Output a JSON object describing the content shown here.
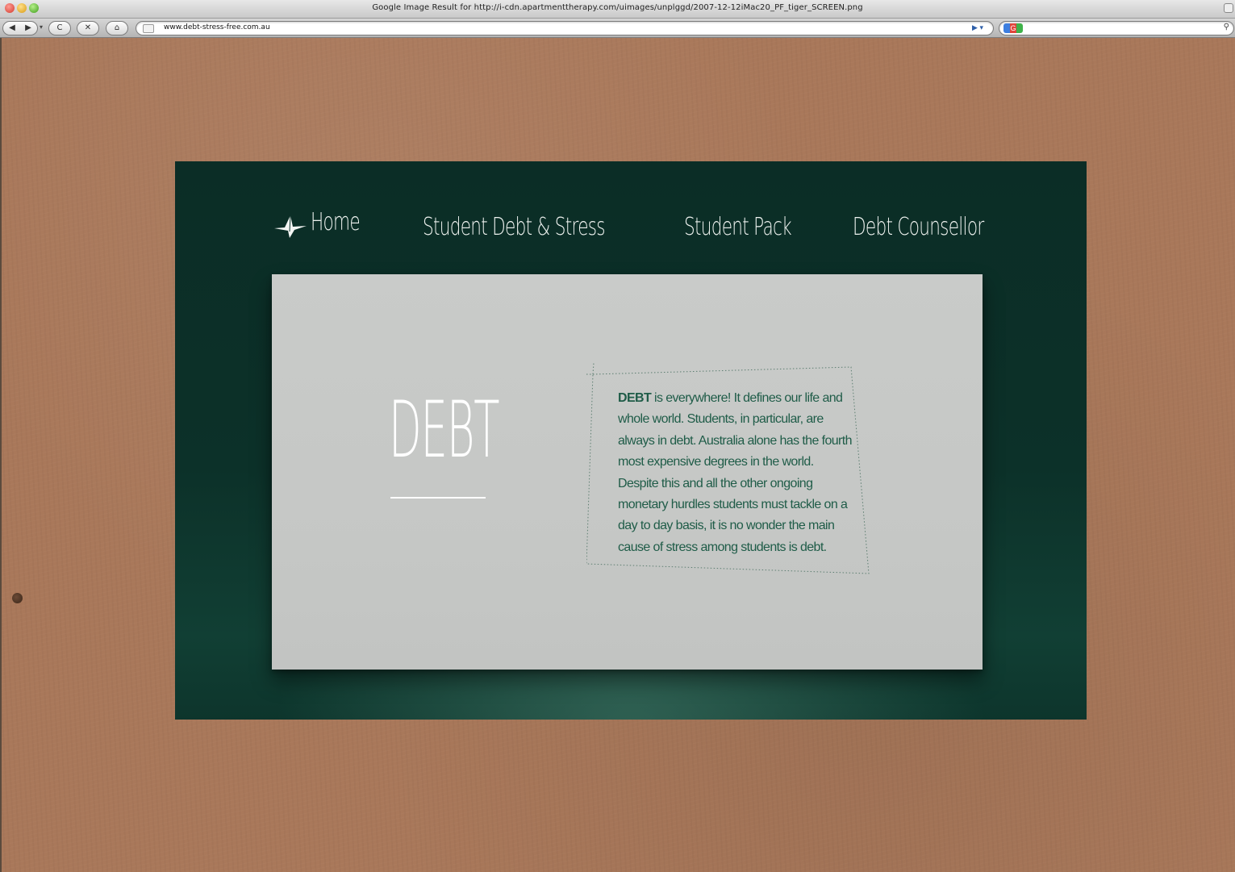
{
  "window": {
    "title": "Google Image Result for http://i-cdn.apartmenttherapy.com/uimages/unplggd/2007-12-12iMac20_PF_tiger_SCREEN.png"
  },
  "toolbar": {
    "back_glyph": "◀",
    "forward_glyph": "▶",
    "dropdown_glyph": "▾",
    "reload_glyph": "C",
    "stop_glyph": "✕",
    "home_glyph": "⌂",
    "url": "www.debt-stress-free.com.au",
    "url_go_glyph": "▶ ▾",
    "search_value": "",
    "search_engine_glyph": "G",
    "search_icon_glyph": "⚲"
  },
  "site": {
    "nav": {
      "home": "Home",
      "student_debt_stress": "Student Debt & Stress",
      "student_pack": "Student Pack",
      "debt_counsellor": "Debt Counsellor"
    },
    "headline": "DEBT",
    "intro_bold": "DEBT",
    "intro_rest": " is everywhere! It defines our life and whole world. Students, in particular, are always in debt. Australia alone has the fourth most expensive degrees in the world. Despite this and all the other ongoing monetary hurdles students must tackle on a day to day basis, it is no wonder the main cause of stress among students is debt."
  },
  "colors": {
    "cardboard": "#a9785a",
    "site_green": "#0c3129",
    "panel_grey": "#c7c9c7",
    "text_green": "#1f5c48",
    "nav_text": "#eef2ef"
  },
  "icons": {
    "logo": "paper-crane-icon"
  }
}
